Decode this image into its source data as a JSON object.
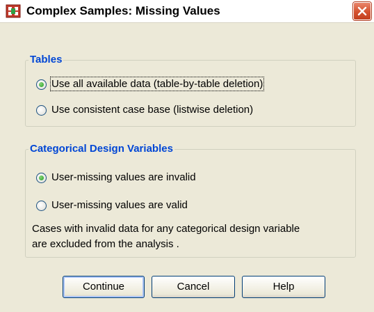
{
  "window": {
    "title": "Complex Samples: Missing Values"
  },
  "tables": {
    "legend": "Tables",
    "options": [
      {
        "label": "Use all available data (table-by-table deletion)",
        "checked": true
      },
      {
        "label": "Use consistent case base (listwise deletion)",
        "checked": false
      }
    ]
  },
  "categorical": {
    "legend": "Categorical Design Variables",
    "options": [
      {
        "label": "User-missing values are invalid",
        "checked": true
      },
      {
        "label": "User-missing values are valid",
        "checked": false
      }
    ],
    "note_line1": "Cases with invalid data for any categorical design variable",
    "note_line2": "are excluded from the analysis ."
  },
  "buttons": {
    "continue": "Continue",
    "cancel": "Cancel",
    "help": "Help"
  },
  "colors": {
    "legend": "#0046d5",
    "dialog_bg": "#ece9d8",
    "close_button": "#d4512e"
  }
}
